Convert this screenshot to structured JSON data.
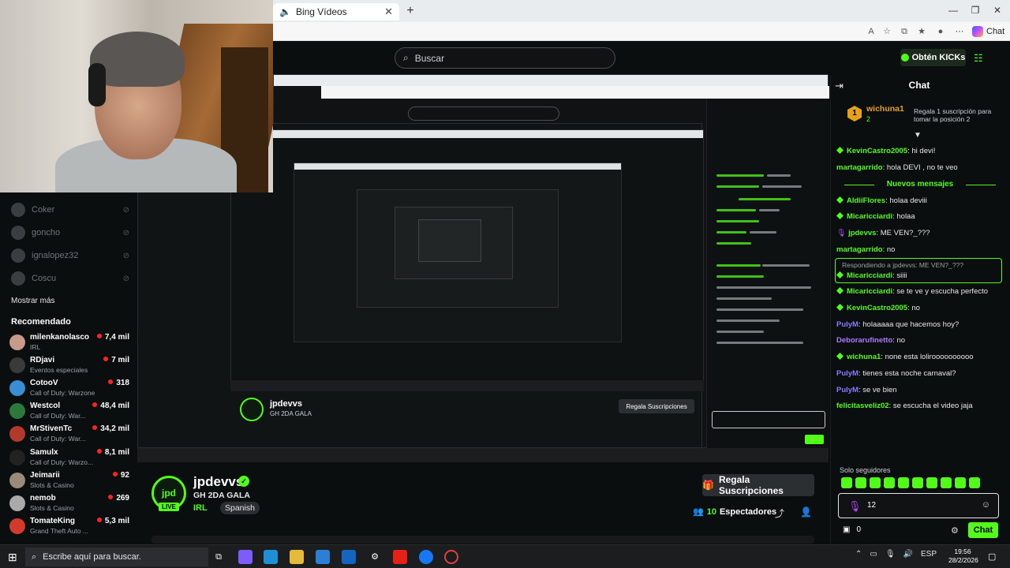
{
  "browser": {
    "tab_title": "Bing Vídeos",
    "tab_close": "✕",
    "new_tab": "+",
    "chat_button": "Chat"
  },
  "kick_header": {
    "search_placeholder": "Buscar",
    "kicks_button": "Obtén KICKs"
  },
  "sidebar": {
    "offline": [
      {
        "name": "Coker"
      },
      {
        "name": "goncho"
      },
      {
        "name": "ignalopez32"
      },
      {
        "name": "Coscu"
      }
    ],
    "show_more": "Mostrar más",
    "recommended_title": "Recomendado",
    "recommended": [
      {
        "name": "milenkanolasco",
        "category": "IRL",
        "viewers": "7,4 mil",
        "color": "#c79a8a"
      },
      {
        "name": "RDjavi",
        "category": "Eventos especiales",
        "viewers": "7 mil",
        "color": "#3a3a3a"
      },
      {
        "name": "CotooV",
        "category": "Call of Duty: Warzone",
        "viewers": "318",
        "color": "#3a8fd4"
      },
      {
        "name": "Westcol",
        "category": "Call of Duty: War...",
        "viewers": "48,4 mil",
        "color": "#2b7a3b"
      },
      {
        "name": "MrStivenTc",
        "category": "Call of Duty: War...",
        "viewers": "34,2 mil",
        "color": "#b23a2a"
      },
      {
        "name": "Samulx",
        "category": "Call of Duty: Warzo...",
        "viewers": "8,1 mil",
        "color": "#222222"
      },
      {
        "name": "Jeimarii",
        "category": "Slots & Casino",
        "viewers": "92",
        "color": "#9a8a7a"
      },
      {
        "name": "nemob",
        "category": "Slots & Casino",
        "viewers": "269",
        "color": "#aaaaaa"
      },
      {
        "name": "TomateKing",
        "category": "Grand Theft Auto ...",
        "viewers": "5,3 mil",
        "color": "#d23a2a"
      }
    ]
  },
  "stream": {
    "avatar_text": "jpd",
    "live": "LIVE",
    "streamer": "jpdevvs",
    "verified": "✓",
    "title": "GH 2DA GALA",
    "category": "IRL",
    "language": "Spanish",
    "subs_button": "Regala Suscripciones",
    "viewers_count": "10",
    "viewers_label": "Espectadores"
  },
  "chat": {
    "title": "Chat",
    "pinned": {
      "rank": "1",
      "user": "wichuna1",
      "count": "2",
      "text": "Regala 1 suscripción para tomar la posición 2"
    },
    "new_messages": "Nuevos mensajes",
    "messages": [
      {
        "user": "KevinCastro2005",
        "text": ": hi devi!",
        "color": "#53fc18",
        "badge": true
      },
      {
        "user": "martagarrido",
        "text": ": hola DEVI , no te veo",
        "color": "#53fc18",
        "badge": false
      },
      {
        "user": "AldiiFlores",
        "text": ": holaa deviii",
        "color": "#53fc18",
        "badge": true
      },
      {
        "user": "Micaricciardi",
        "text": ": holaa",
        "color": "#53fc18",
        "badge": true
      },
      {
        "user": "jpdevvs",
        "text": ": ME VEN?_???",
        "color": "#53fc18",
        "badge": false,
        "mic": true
      },
      {
        "user": "martagarrido",
        "text": ": no",
        "color": "#53fc18",
        "badge": false
      },
      {
        "user": "Micaricciardi",
        "text": ": se te ve y escucha perfecto",
        "color": "#53fc18",
        "badge": true
      },
      {
        "user": "KevinCastro2005",
        "text": ": no",
        "color": "#53fc18",
        "badge": true
      },
      {
        "user": "PulyM",
        "text": ": holaaaaa que hacemos hoy?",
        "color": "#8c7bff",
        "badge": false
      },
      {
        "user": "Deborarufinetto",
        "text": ": no",
        "color": "#b07bff",
        "badge": false
      },
      {
        "user": "wichuna1",
        "text": ": none esta loliroooooooooo",
        "color": "#53fc18",
        "badge": true
      },
      {
        "user": "PulyM",
        "text": ": tienes esta noche carnaval?",
        "color": "#8c7bff",
        "badge": false
      },
      {
        "user": "PulyM",
        "text": ": se ve bien",
        "color": "#8c7bff",
        "badge": false
      },
      {
        "user": "felicitasveliz02",
        "text": ": se escucha el video jaja",
        "color": "#53fc18",
        "badge": false
      }
    ],
    "reply": {
      "label": "Respondiendo a jpdevvs: ME VEN?_???",
      "user": "Micaricciardi",
      "text": ": siiii"
    },
    "followers_only": "Solo seguidores",
    "input_value": "12",
    "kicks_balance": "0",
    "send": "Chat"
  },
  "taskbar": {
    "search_placeholder": "Escribe aquí para buscar.",
    "lang": "ESP",
    "time": "19:56",
    "date": "28/2/2026"
  }
}
